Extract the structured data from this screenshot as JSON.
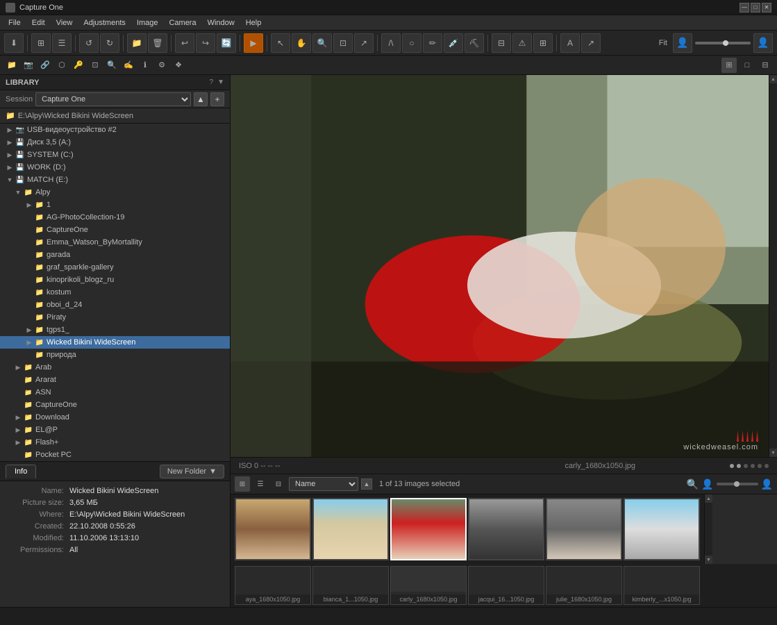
{
  "titlebar": {
    "title": "Capture One",
    "controls": [
      "—",
      "□",
      "✕"
    ]
  },
  "menubar": {
    "items": [
      "File",
      "Edit",
      "View",
      "Adjustments",
      "Image",
      "Camera",
      "Window",
      "Help"
    ]
  },
  "toolbar": {
    "fit_label": "Fit"
  },
  "library": {
    "title": "LIBRARY",
    "session_label": "Session",
    "session_value": "Capture One",
    "path": "E:\\Alpy\\Wicked Bikini WideScreen"
  },
  "tree": {
    "items": [
      {
        "label": "USB-видеоустройство #2",
        "indent": 1,
        "type": "device",
        "expanded": false
      },
      {
        "label": "Диск 3,5 (A:)",
        "indent": 1,
        "type": "drive",
        "expanded": false
      },
      {
        "label": "SYSTEM (C:)",
        "indent": 1,
        "type": "drive",
        "expanded": false
      },
      {
        "label": "WORK (D:)",
        "indent": 1,
        "type": "drive",
        "expanded": false
      },
      {
        "label": "MATCH (E:)",
        "indent": 1,
        "type": "drive",
        "expanded": true
      },
      {
        "label": "Alpy",
        "indent": 2,
        "type": "folder",
        "expanded": true
      },
      {
        "label": "1",
        "indent": 3,
        "type": "folder",
        "expanded": false
      },
      {
        "label": "AG-PhotoCollection-19",
        "indent": 3,
        "type": "folder",
        "expanded": false
      },
      {
        "label": "CaptureOne",
        "indent": 3,
        "type": "folder",
        "expanded": false
      },
      {
        "label": "Emma_Watson_ByMortallity",
        "indent": 3,
        "type": "folder",
        "expanded": false
      },
      {
        "label": "garada",
        "indent": 3,
        "type": "folder",
        "expanded": false
      },
      {
        "label": "graf_sparkle-gallery",
        "indent": 3,
        "type": "folder",
        "expanded": false
      },
      {
        "label": "kinoprikoli_blogz_ru",
        "indent": 3,
        "type": "folder",
        "expanded": false
      },
      {
        "label": "kostum",
        "indent": 3,
        "type": "folder",
        "expanded": false
      },
      {
        "label": "oboi_d_24",
        "indent": 3,
        "type": "folder",
        "expanded": false
      },
      {
        "label": "Piraty",
        "indent": 3,
        "type": "folder",
        "expanded": false
      },
      {
        "label": "tgps1_",
        "indent": 3,
        "type": "folder",
        "expanded": false
      },
      {
        "label": "Wicked Bikini WideScreen",
        "indent": 3,
        "type": "folder",
        "expanded": false,
        "selected": true
      },
      {
        "label": "природа",
        "indent": 3,
        "type": "folder",
        "expanded": false
      },
      {
        "label": "Arab",
        "indent": 2,
        "type": "folder",
        "expanded": false
      },
      {
        "label": "Ararat",
        "indent": 2,
        "type": "folder",
        "expanded": false
      },
      {
        "label": "ASN",
        "indent": 2,
        "type": "folder",
        "expanded": false
      },
      {
        "label": "CaptureOne",
        "indent": 2,
        "type": "folder",
        "expanded": false
      },
      {
        "label": "Download",
        "indent": 2,
        "type": "folder",
        "expanded": false
      },
      {
        "label": "EL@P",
        "indent": 2,
        "type": "folder",
        "expanded": false
      },
      {
        "label": "Flash+",
        "indent": 2,
        "type": "folder",
        "expanded": false
      },
      {
        "label": "Pocket PC",
        "indent": 2,
        "type": "folder",
        "expanded": false
      }
    ]
  },
  "info": {
    "tab_label": "Info",
    "new_folder_label": "New Folder",
    "fields": {
      "name_label": "Name:",
      "name_value": "Wicked Bikini WideScreen",
      "size_label": "Picture size:",
      "size_value": "3,65 МБ",
      "where_label": "Where:",
      "where_value": "E:\\Alpy\\Wicked Bikini WideScreen",
      "created_label": "Created:",
      "created_value": "22.10.2008 0:55:26",
      "modified_label": "Modified:",
      "modified_value": "11.10.2006 13:13:10",
      "permissions_label": "Permissions:",
      "permissions_value": "All"
    }
  },
  "preview": {
    "status_left": "ISO 0  --  --  --",
    "status_center": "carly_1680x1050.jpg",
    "watermark": "wickedweasel.com"
  },
  "thumbnails": {
    "view_mode": "grid",
    "sort_label": "Name",
    "count_text": "1 of 13 images selected",
    "images": [
      {
        "name": "aya_1680x1050.jpg",
        "color": "t1"
      },
      {
        "name": "bianca_1...1050.jpg",
        "color": "t2"
      },
      {
        "name": "carly_1680x1050.jpg",
        "color": "t3",
        "selected": true
      },
      {
        "name": "jacqui_16...1050.jpg",
        "color": "t4"
      },
      {
        "name": "julie_1680x1050.jpg",
        "color": "t5"
      },
      {
        "name": "kimberly_...x1050.jpg",
        "color": "t6"
      }
    ]
  }
}
